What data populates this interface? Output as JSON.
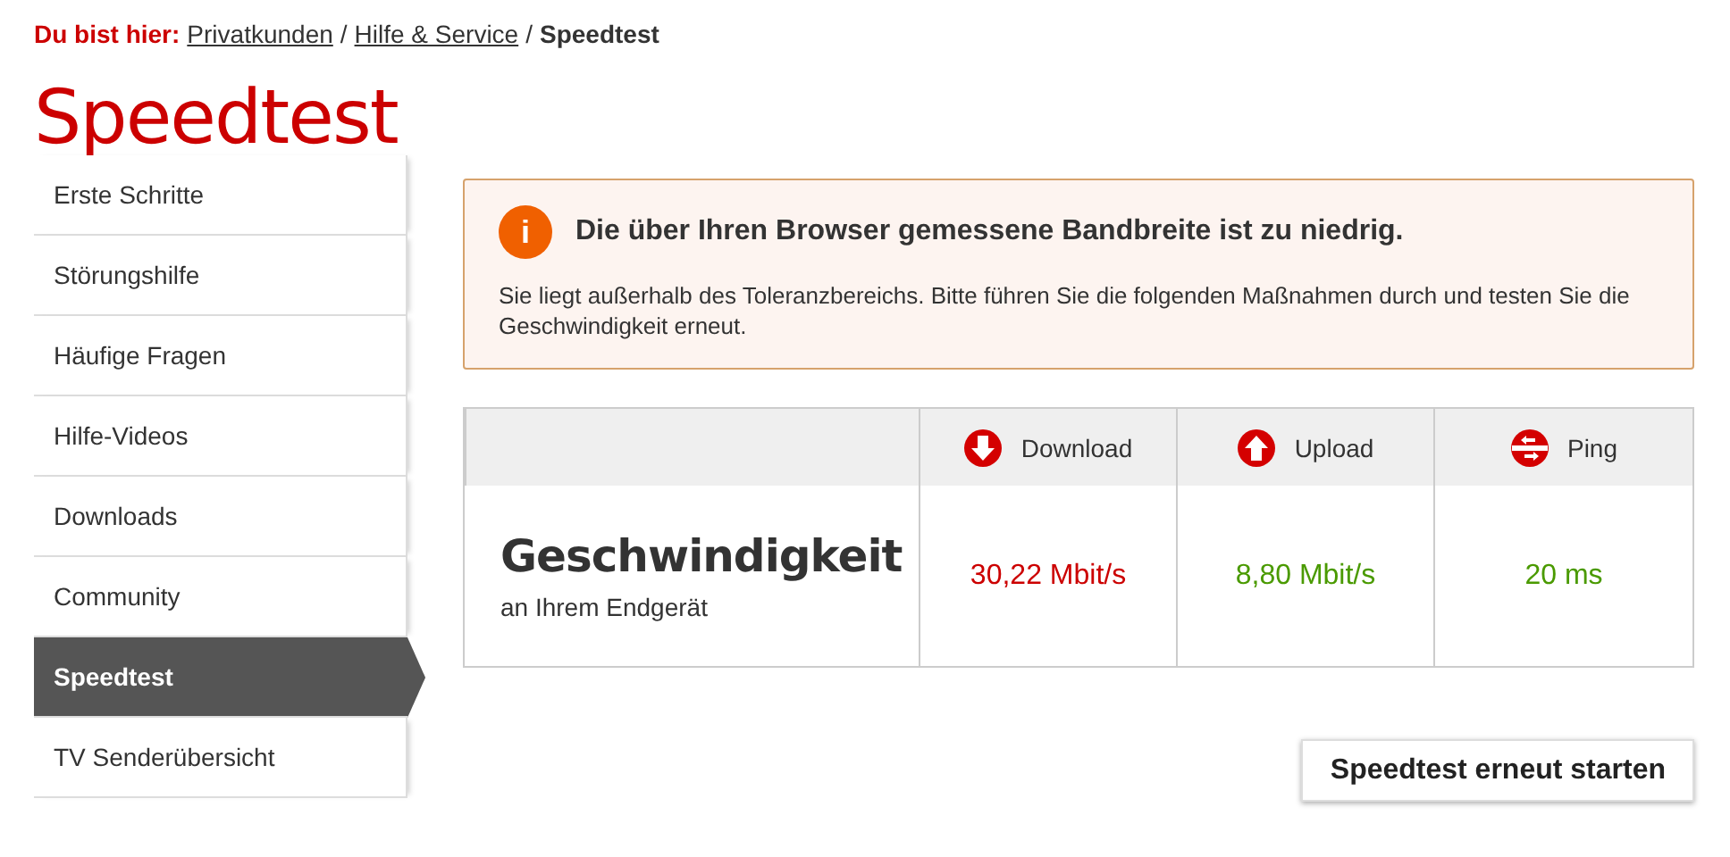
{
  "breadcrumb": {
    "label": "Du bist hier:",
    "links": [
      {
        "label": "Privatkunden",
        "separator": "/"
      },
      {
        "label": "Hilfe & Service",
        "separator": "/"
      }
    ],
    "current": "Speedtest"
  },
  "title": "Speedtest",
  "sidebar": {
    "items": [
      {
        "label": "Erste Schritte",
        "selected": false
      },
      {
        "label": "Störungshilfe",
        "selected": false
      },
      {
        "label": "Häufige Fragen",
        "selected": false
      },
      {
        "label": "Hilfe-Videos",
        "selected": false
      },
      {
        "label": "Downloads",
        "selected": false
      },
      {
        "label": "Community",
        "selected": false
      },
      {
        "label": "Speedtest",
        "selected": true
      },
      {
        "label": "TV Senderübersicht",
        "selected": false
      }
    ]
  },
  "alert": {
    "icon": "i",
    "heading": "Die über Ihren Browser gemessene Bandbreite ist zu niedrig.",
    "text": "Sie liegt außerhalb des Toleranzbereichs. Bitte führen Sie die folgenden Maßnahmen durch und testen Sie die Geschwindigkeit erneut."
  },
  "results": {
    "heading": "Geschwindigkeit",
    "subheading": "an Ihrem Endgerät",
    "metrics": [
      {
        "kind": "download",
        "label": "Download",
        "value": "30,22 Mbit/s",
        "color": "#cc0000"
      },
      {
        "kind": "upload",
        "label": "Upload",
        "value": "8,80 Mbit/s",
        "color": "#4a9a00"
      },
      {
        "kind": "ping",
        "label": "Ping",
        "value": "20 ms",
        "color": "#4a9a00"
      }
    ]
  },
  "restart_button": "Speedtest erneut starten"
}
